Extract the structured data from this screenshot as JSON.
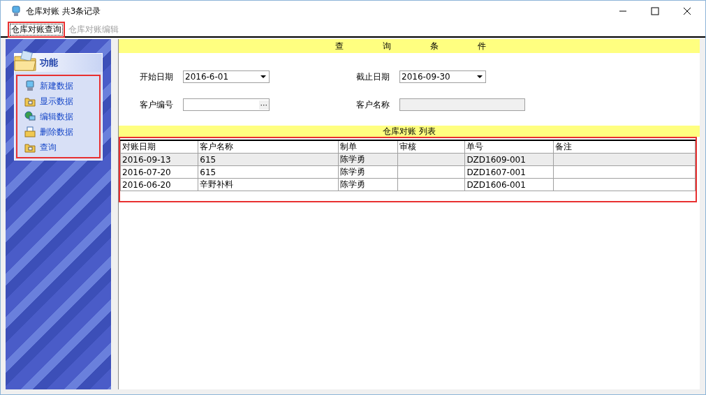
{
  "window": {
    "title": "仓库对账 共3条记录"
  },
  "tabs": [
    {
      "label": "仓库对账查询",
      "selected": true
    },
    {
      "label": "仓库对账编辑",
      "selected": false
    }
  ],
  "sidebar": {
    "title": "功能",
    "items": [
      {
        "label": "新建数据",
        "kind": "computer"
      },
      {
        "label": "显示数据",
        "kind": "folder"
      },
      {
        "label": "编辑数据",
        "kind": "network"
      },
      {
        "label": "删除数据",
        "kind": "printer"
      },
      {
        "label": "查询",
        "kind": "folder"
      }
    ]
  },
  "query": {
    "title": "查 询 条 件",
    "fields": [
      {
        "label": "开始日期",
        "value": "2016-6-01",
        "kind": "date"
      },
      {
        "label": "截止日期",
        "value": "2016-09-30",
        "kind": "date"
      },
      {
        "label": "客户编号",
        "kind": "lookup",
        "button": "···"
      },
      {
        "label": "客户名称",
        "kind": "readonly"
      }
    ]
  },
  "table": {
    "title": "仓库对账 列表",
    "columns": [
      "对账日期",
      "客户名称",
      "制单",
      "审核",
      "单号",
      "备注"
    ],
    "rows": [
      {
        "cells": [
          "2016-09-13",
          "615",
          "陈学勇",
          null,
          "DZD1609-001",
          null
        ],
        "selected": true
      },
      {
        "cells": [
          "2016-07-20",
          "615",
          "陈学勇",
          null,
          "DZD1607-001",
          null
        ],
        "selected": false
      },
      {
        "cells": [
          "2016-06-20",
          "辛野补料",
          "陈学勇",
          null,
          "DZD1606-001",
          null
        ],
        "selected": false
      }
    ]
  }
}
